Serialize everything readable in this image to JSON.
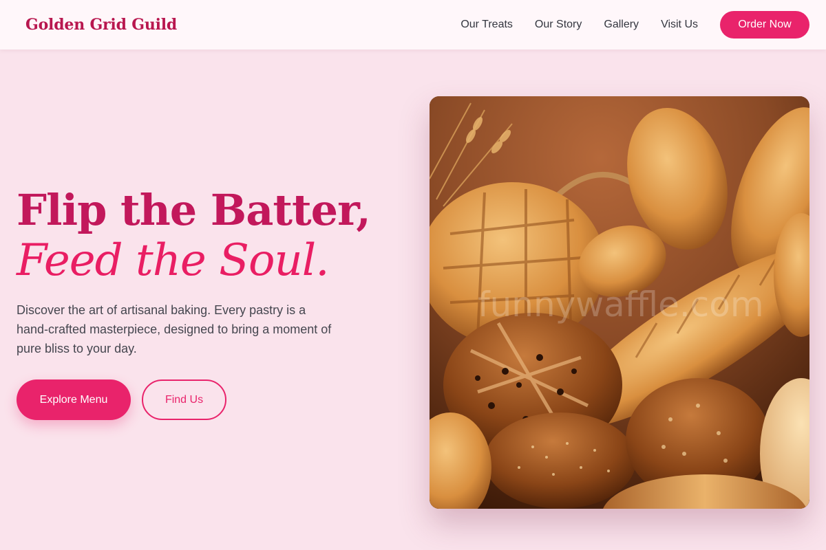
{
  "brand": {
    "name": "Golden Grid Guild"
  },
  "nav": {
    "links": [
      {
        "label": "Our Treats"
      },
      {
        "label": "Our Story"
      },
      {
        "label": "Gallery"
      },
      {
        "label": "Visit Us"
      }
    ],
    "cta": "Order Now"
  },
  "hero": {
    "title_line1": "Flip the Batter,",
    "title_line2": "Feed the Soul.",
    "description": "Discover the art of artisanal baking. Every pastry is a hand-crafted masterpiece, designed to bring a moment of pure bliss to your day.",
    "primary_button": "Explore Menu",
    "secondary_button": "Find Us"
  },
  "image": {
    "watermark": "funnywaffle.com"
  },
  "colors": {
    "brand": "#b8174f",
    "accent": "#e9236b",
    "background": "#fae3ec",
    "navbar": "#fff7fa",
    "text": "#45464f"
  }
}
